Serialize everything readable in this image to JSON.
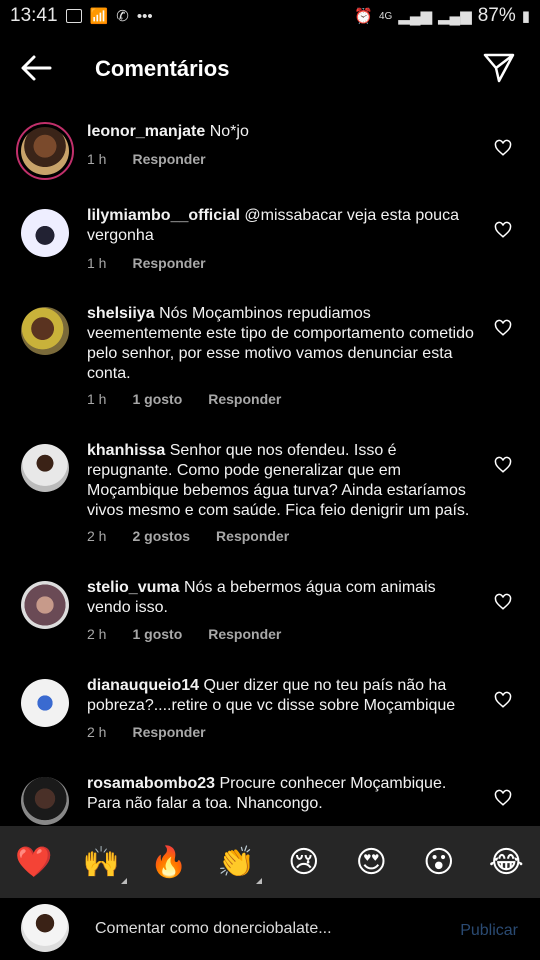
{
  "status_bar": {
    "time": "13:41",
    "network": "4G",
    "battery": "87%"
  },
  "header": {
    "title": "Comentários"
  },
  "comments": [
    {
      "user": "leonor_manjate",
      "text": "No*jo",
      "time": "1 h",
      "likes": "",
      "reply": "Responder"
    },
    {
      "user": "lilymiambo__official",
      "text": "@missabacar veja esta pouca vergonha",
      "time": "1 h",
      "likes": "",
      "reply": "Responder"
    },
    {
      "user": "shelsiiya",
      "text": "Nós Moçambinos repudiamos veementemente este tipo de comportamento cometido pelo senhor, por esse motivo vamos denunciar esta conta.",
      "time": "1 h",
      "likes": "1 gosto",
      "reply": "Responder"
    },
    {
      "user": "khanhissa",
      "text": "Senhor que nos ofendeu. Isso é repugnante. Como pode generalizar que em Moçambique bebemos água turva? Ainda estaríamos vivos mesmo e com saúde. Fica feio denigrir um país.",
      "time": "2 h",
      "likes": "2 gostos",
      "reply": "Responder"
    },
    {
      "user": "stelio_vuma",
      "text": "Nós a bebermos água com animais vendo isso.",
      "time": "2 h",
      "likes": "1 gosto",
      "reply": "Responder"
    },
    {
      "user": "dianauqueio14",
      "text": "Quer dizer que no teu país não ha pobreza?....retire o que vc disse sobre Moçambique",
      "time": "2 h",
      "likes": "",
      "reply": "Responder"
    },
    {
      "user": "rosamabombo23",
      "text": "Procure conhecer Moçambique. Para não falar a toa. Nhancongo.",
      "time": "",
      "likes": "",
      "reply": ""
    }
  ],
  "reactions": [
    "❤️",
    "🙌",
    "🔥",
    "👏",
    "😢",
    "😍",
    "😮",
    "😂"
  ],
  "composer": {
    "placeholder": "Comentar como donerciobalate...",
    "publish_label": "Publicar"
  },
  "colors": {
    "background": "#000000",
    "reaction_bar": "#262626",
    "story_ring": "#c1306b",
    "meta_text": "#9a9a9a",
    "publish_disabled": "#2a4a72"
  }
}
